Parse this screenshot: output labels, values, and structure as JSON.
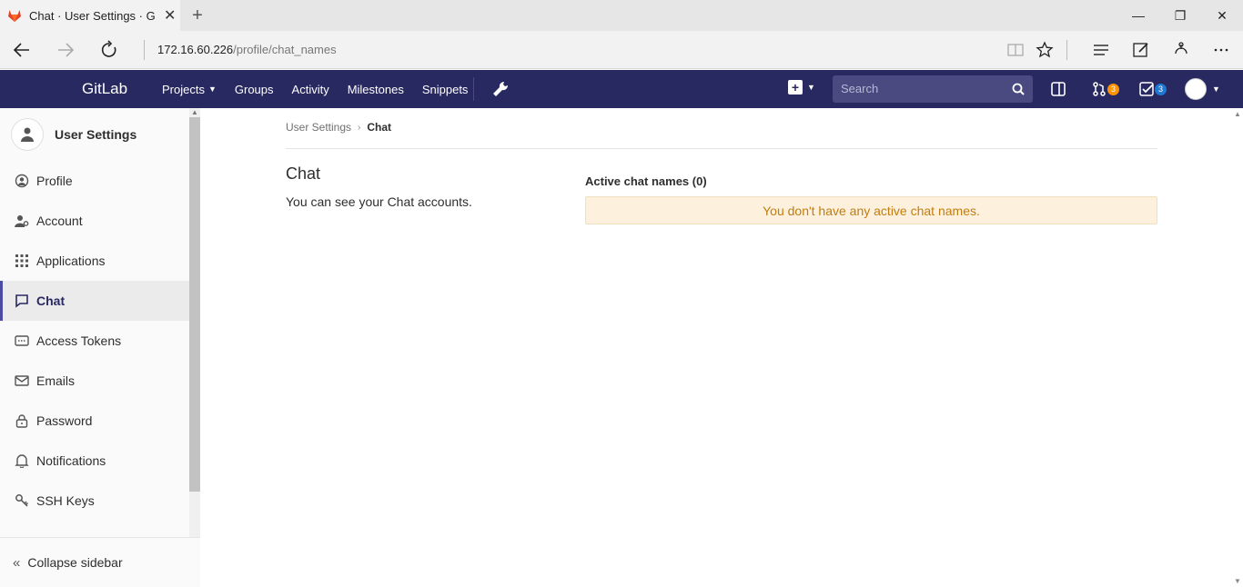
{
  "browser": {
    "tab_title": "Chat · User Settings · GitLab",
    "address_host": "172.16.60.226",
    "address_path": "/profile/chat_names"
  },
  "header": {
    "logo": "GitLab",
    "nav": [
      "Projects",
      "Groups",
      "Activity",
      "Milestones",
      "Snippets"
    ],
    "search_placeholder": "Search",
    "merge_requests_count": "3",
    "todos_count": "3"
  },
  "sidebar": {
    "title": "User Settings",
    "items": [
      {
        "label": "Profile",
        "icon": "profile-icon"
      },
      {
        "label": "Account",
        "icon": "account-icon"
      },
      {
        "label": "Applications",
        "icon": "applications-icon"
      },
      {
        "label": "Chat",
        "icon": "chat-icon",
        "active": true
      },
      {
        "label": "Access Tokens",
        "icon": "token-icon"
      },
      {
        "label": "Emails",
        "icon": "envelope-icon"
      },
      {
        "label": "Password",
        "icon": "lock-icon"
      },
      {
        "label": "Notifications",
        "icon": "bell-icon"
      },
      {
        "label": "SSH Keys",
        "icon": "key-icon"
      }
    ],
    "collapse_label": "Collapse sidebar"
  },
  "main": {
    "breadcrumb": [
      "User Settings",
      "Chat"
    ],
    "section_title": "Chat",
    "section_description": "You can see your Chat accounts.",
    "active_title": "Active chat names (0)",
    "empty_message": "You don't have any active chat names."
  },
  "colors": {
    "header_bg": "#292961",
    "alert_bg": "#fdf1dd",
    "alert_text": "#c17d10"
  }
}
